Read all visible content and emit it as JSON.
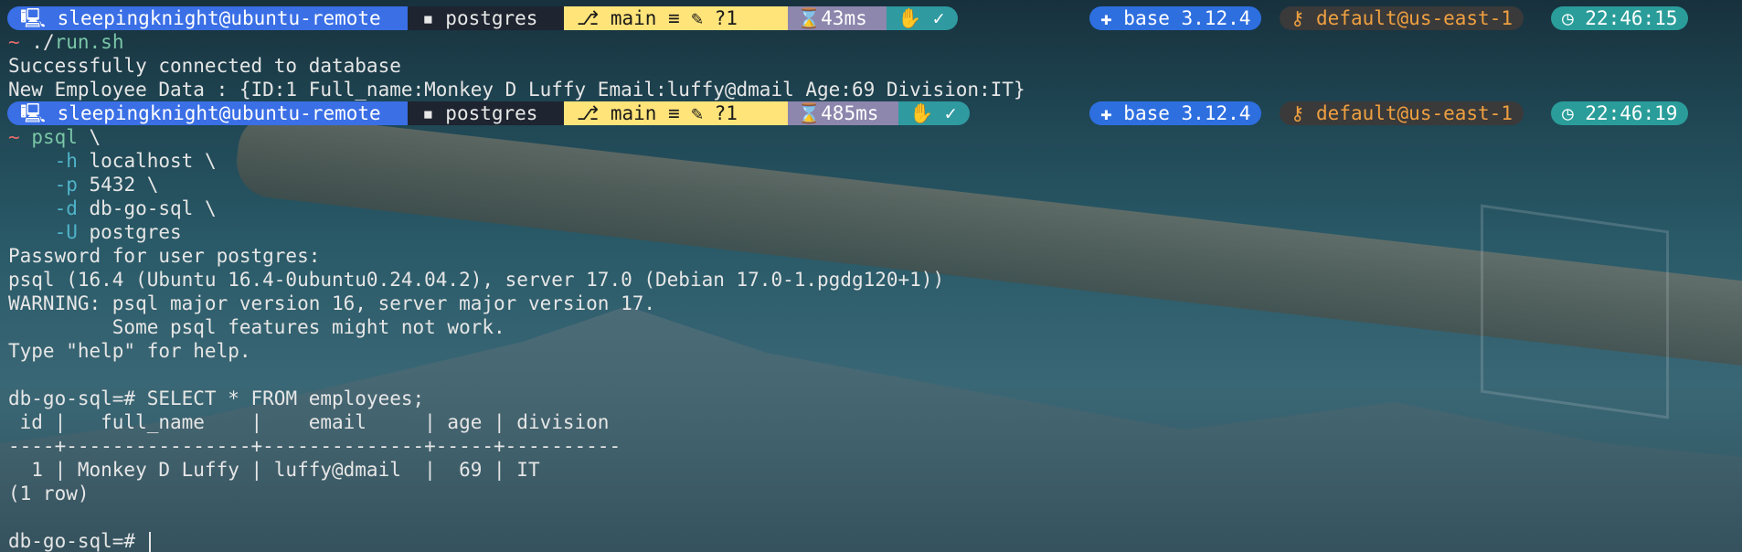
{
  "prompt_1": {
    "user": "sleepingknight@ubuntu-remote",
    "dir": "postgres",
    "git": "main ≡ ✎ ?1",
    "duration": "43ms",
    "status": "✓",
    "conda": "base 3.12.4",
    "aws": "default@us-east-1",
    "clock": "22:46:15"
  },
  "cmd_1": {
    "tilde": "~",
    "path_prefix": "./",
    "path": "run.sh"
  },
  "output_1": [
    "Successfully connected to database",
    "New Employee Data : {ID:1 Full_name:Monkey D Luffy Email:luffy@dmail Age:69 Division:IT}"
  ],
  "prompt_2": {
    "user": "sleepingknight@ubuntu-remote",
    "dir": "postgres",
    "git": "main ≡ ✎ ?1",
    "duration": "485ms",
    "status": "✓",
    "conda": "base 3.12.4",
    "aws": "default@us-east-1",
    "clock": "22:46:19"
  },
  "cmd_2": {
    "tilde": "~",
    "program": "psql",
    "cont": " \\",
    "args": [
      {
        "flag": "-h",
        "value": " localhost \\"
      },
      {
        "flag": "-p",
        "value": " 5432 \\"
      },
      {
        "flag": "-d",
        "value": " db-go-sql \\"
      },
      {
        "flag": "-U",
        "value": " postgres"
      }
    ]
  },
  "output_2": [
    "Password for user postgres:",
    "psql (16.4 (Ubuntu 16.4-0ubuntu0.24.04.2), server 17.0 (Debian 17.0-1.pgdg120+1))",
    "WARNING: psql major version 16, server major version 17.",
    "         Some psql features might not work.",
    "Type \"help\" for help."
  ],
  "sql": {
    "prompt": "db-go-sql=#",
    "query": " SELECT * FROM employees;",
    "header": " id |   full_name    |    email     | age | division",
    "separator": "----+----------------+--------------+-----+----------",
    "rows": [
      "  1 | Monkey D Luffy | luffy@dmail  |  69 | IT"
    ],
    "footer": "(1 row)",
    "final_prompt": "db-go-sql=# "
  },
  "colors": {
    "user_bg": "#3a6fe6",
    "dir_bg": "#1e2430",
    "git_bg": "#ffe47a",
    "time_bg": "#8d86ad",
    "status_bg": "#2f9aa0",
    "conda_bg": "#2e6fe0",
    "aws_fg": "#f0a040",
    "clock_bg": "#2a9d9a"
  },
  "icons": {
    "user": "computer-icon",
    "dir": "folder-icon",
    "git": "github-branch-icon",
    "duration": "timer-icon",
    "status": "hand-check-icon",
    "conda": "python-icon",
    "aws": "key-icon",
    "clock": "clock-icon"
  }
}
